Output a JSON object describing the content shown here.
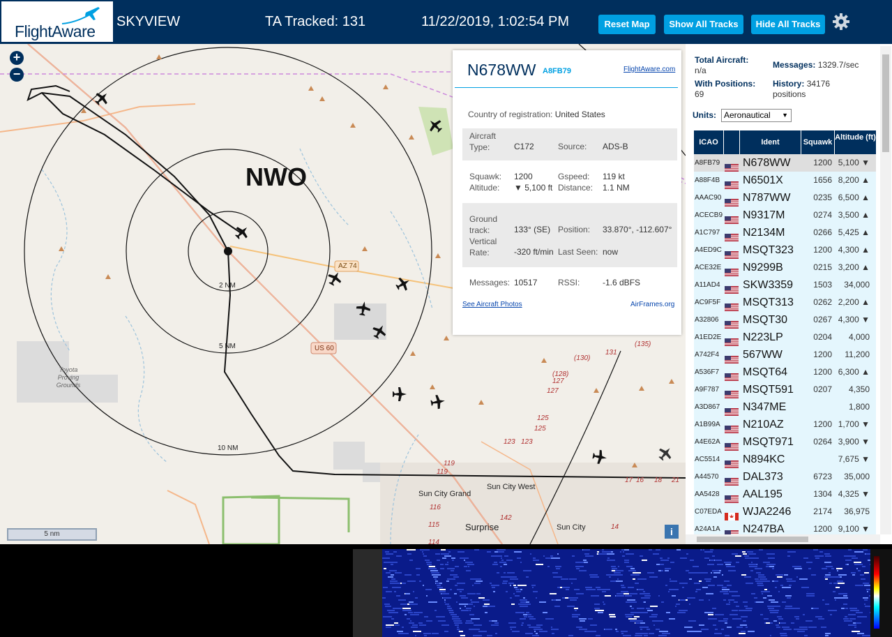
{
  "header": {
    "logo_text": "FlightAware",
    "app_title": "SKYVIEW",
    "tracked_label": "TA Tracked: 131",
    "timestamp": "11/22/2019, 1:02:54 PM",
    "buttons": {
      "reset_map": "Reset Map",
      "show_all_tracks": "Show All Tracks",
      "hide_all_tracks": "Hide All Tracks"
    },
    "brand_color": "#002f5d",
    "accent_color": "#00a0e2"
  },
  "map": {
    "site_label": "NWO",
    "zoom_in": "+",
    "zoom_out": "−",
    "ring_labels": [
      "2 NM",
      "5 NM",
      "10 NM"
    ],
    "road_labels": {
      "az74": "AZ 74",
      "us60": "US 60"
    },
    "place_labels": {
      "toyota": "Toyota Proving Grounds",
      "sun_city_west": "Sun City West",
      "sun_city_grand": "Sun City Grand",
      "surprise": "Surprise",
      "sun_city": "Sun City"
    },
    "route_numbers": [
      "(135)",
      "131",
      "(130)",
      "(128)",
      "127",
      "127",
      "125",
      "125",
      "123",
      "123",
      "119",
      "119",
      "116",
      "115",
      "114",
      "142",
      "14",
      "17",
      "16",
      "18",
      "21"
    ],
    "scale_label": "5 nm",
    "info_button": "i"
  },
  "selected_aircraft": {
    "ident": "N678WW",
    "icao": "A8FB79",
    "link_flightaware": "FlightAware.com",
    "country_label": "Country of registration:",
    "country": "United States",
    "aircraft_type_label": "Aircraft Type:",
    "aircraft_type": "C172",
    "source_label": "Source:",
    "source": "ADS-B",
    "squawk_label": "Squawk:",
    "squawk": "1200",
    "gspeed_label": "Gspeed:",
    "gspeed": "119 kt",
    "altitude_label": "Altitude:",
    "altitude": "▼ 5,100 ft",
    "distance_label": "Distance:",
    "distance": "1.1 NM",
    "ground_track_label": "Ground track:",
    "ground_track": "133° (SE)",
    "position_label": "Position:",
    "position": "33.870°, -112.607°",
    "vertical_rate_label": "Vertical Rate:",
    "vertical_rate": "-320 ft/min",
    "last_seen_label": "Last Seen:",
    "last_seen": "now",
    "messages_label": "Messages:",
    "messages": "10517",
    "rssi_label": "RSSI:",
    "rssi": "-1.6 dBFS",
    "link_photos": "See Aircraft Photos",
    "link_airframes": "AirFrames.org"
  },
  "stats": {
    "total_aircraft_label": "Total Aircraft:",
    "total_aircraft": "n/a",
    "messages_label": "Messages:",
    "messages": "1329.7/sec",
    "with_positions_label": "With Positions:",
    "with_positions": "69",
    "history_label": "History:",
    "history": "34176",
    "history_unit": "positions",
    "units_label": "Units:",
    "units_value": "Aeronautical"
  },
  "table": {
    "headers": [
      "ICAO",
      "",
      "Ident",
      "Squawk",
      "Altitude (ft)"
    ],
    "rows": [
      {
        "icao": "A8FB79",
        "flag": "US",
        "ident": "N678WW",
        "squawk": "1200",
        "alt": "5,100 ▼"
      },
      {
        "icao": "A88F4B",
        "flag": "US",
        "ident": "N6501X",
        "squawk": "1656",
        "alt": "8,200 ▲"
      },
      {
        "icao": "AAAC90",
        "flag": "US",
        "ident": "N787WW",
        "squawk": "0235",
        "alt": "6,500 ▲"
      },
      {
        "icao": "ACECB9",
        "flag": "US",
        "ident": "N9317M",
        "squawk": "0274",
        "alt": "3,500 ▲"
      },
      {
        "icao": "A1C797",
        "flag": "US",
        "ident": "N2134M",
        "squawk": "0266",
        "alt": "5,425 ▲"
      },
      {
        "icao": "A4ED9C",
        "flag": "US",
        "ident": "MSQT323",
        "squawk": "1200",
        "alt": "4,300 ▲"
      },
      {
        "icao": "ACE32E",
        "flag": "US",
        "ident": "N9299B",
        "squawk": "0215",
        "alt": "3,200 ▲"
      },
      {
        "icao": "A11AD4",
        "flag": "US",
        "ident": "SKW3359",
        "squawk": "1503",
        "alt": "34,000"
      },
      {
        "icao": "AC9F5F",
        "flag": "US",
        "ident": "MSQT313",
        "squawk": "0262",
        "alt": "2,200 ▲"
      },
      {
        "icao": "A32806",
        "flag": "US",
        "ident": "MSQT30",
        "squawk": "0267",
        "alt": "4,300 ▼"
      },
      {
        "icao": "A1ED2E",
        "flag": "US",
        "ident": "N223LP",
        "squawk": "0204",
        "alt": "4,000"
      },
      {
        "icao": "A742F4",
        "flag": "US",
        "ident": "567WW",
        "squawk": "1200",
        "alt": "11,200"
      },
      {
        "icao": "A536F7",
        "flag": "US",
        "ident": "MSQT64",
        "squawk": "1200",
        "alt": "6,300 ▲"
      },
      {
        "icao": "A9F787",
        "flag": "US",
        "ident": "MSQT591",
        "squawk": "0207",
        "alt": "4,350"
      },
      {
        "icao": "A3D867",
        "flag": "US",
        "ident": "N347ME",
        "squawk": "",
        "alt": "1,800"
      },
      {
        "icao": "A1B99A",
        "flag": "US",
        "ident": "N210AZ",
        "squawk": "1200",
        "alt": "1,700 ▼"
      },
      {
        "icao": "A4E62A",
        "flag": "US",
        "ident": "MSQT971",
        "squawk": "0264",
        "alt": "3,900 ▼"
      },
      {
        "icao": "AC5514",
        "flag": "US",
        "ident": "N894KC",
        "squawk": "",
        "alt": "7,675 ▼"
      },
      {
        "icao": "A44570",
        "flag": "US",
        "ident": "DAL373",
        "squawk": "6723",
        "alt": "35,000"
      },
      {
        "icao": "AA5428",
        "flag": "US",
        "ident": "AAL195",
        "squawk": "1304",
        "alt": "4,325 ▼"
      },
      {
        "icao": "C07EDA",
        "flag": "CA",
        "ident": "WJA2246",
        "squawk": "2174",
        "alt": "36,975"
      },
      {
        "icao": "A24A1A",
        "flag": "US",
        "ident": "N247BA",
        "squawk": "1200",
        "alt": "9,100 ▼"
      }
    ]
  }
}
